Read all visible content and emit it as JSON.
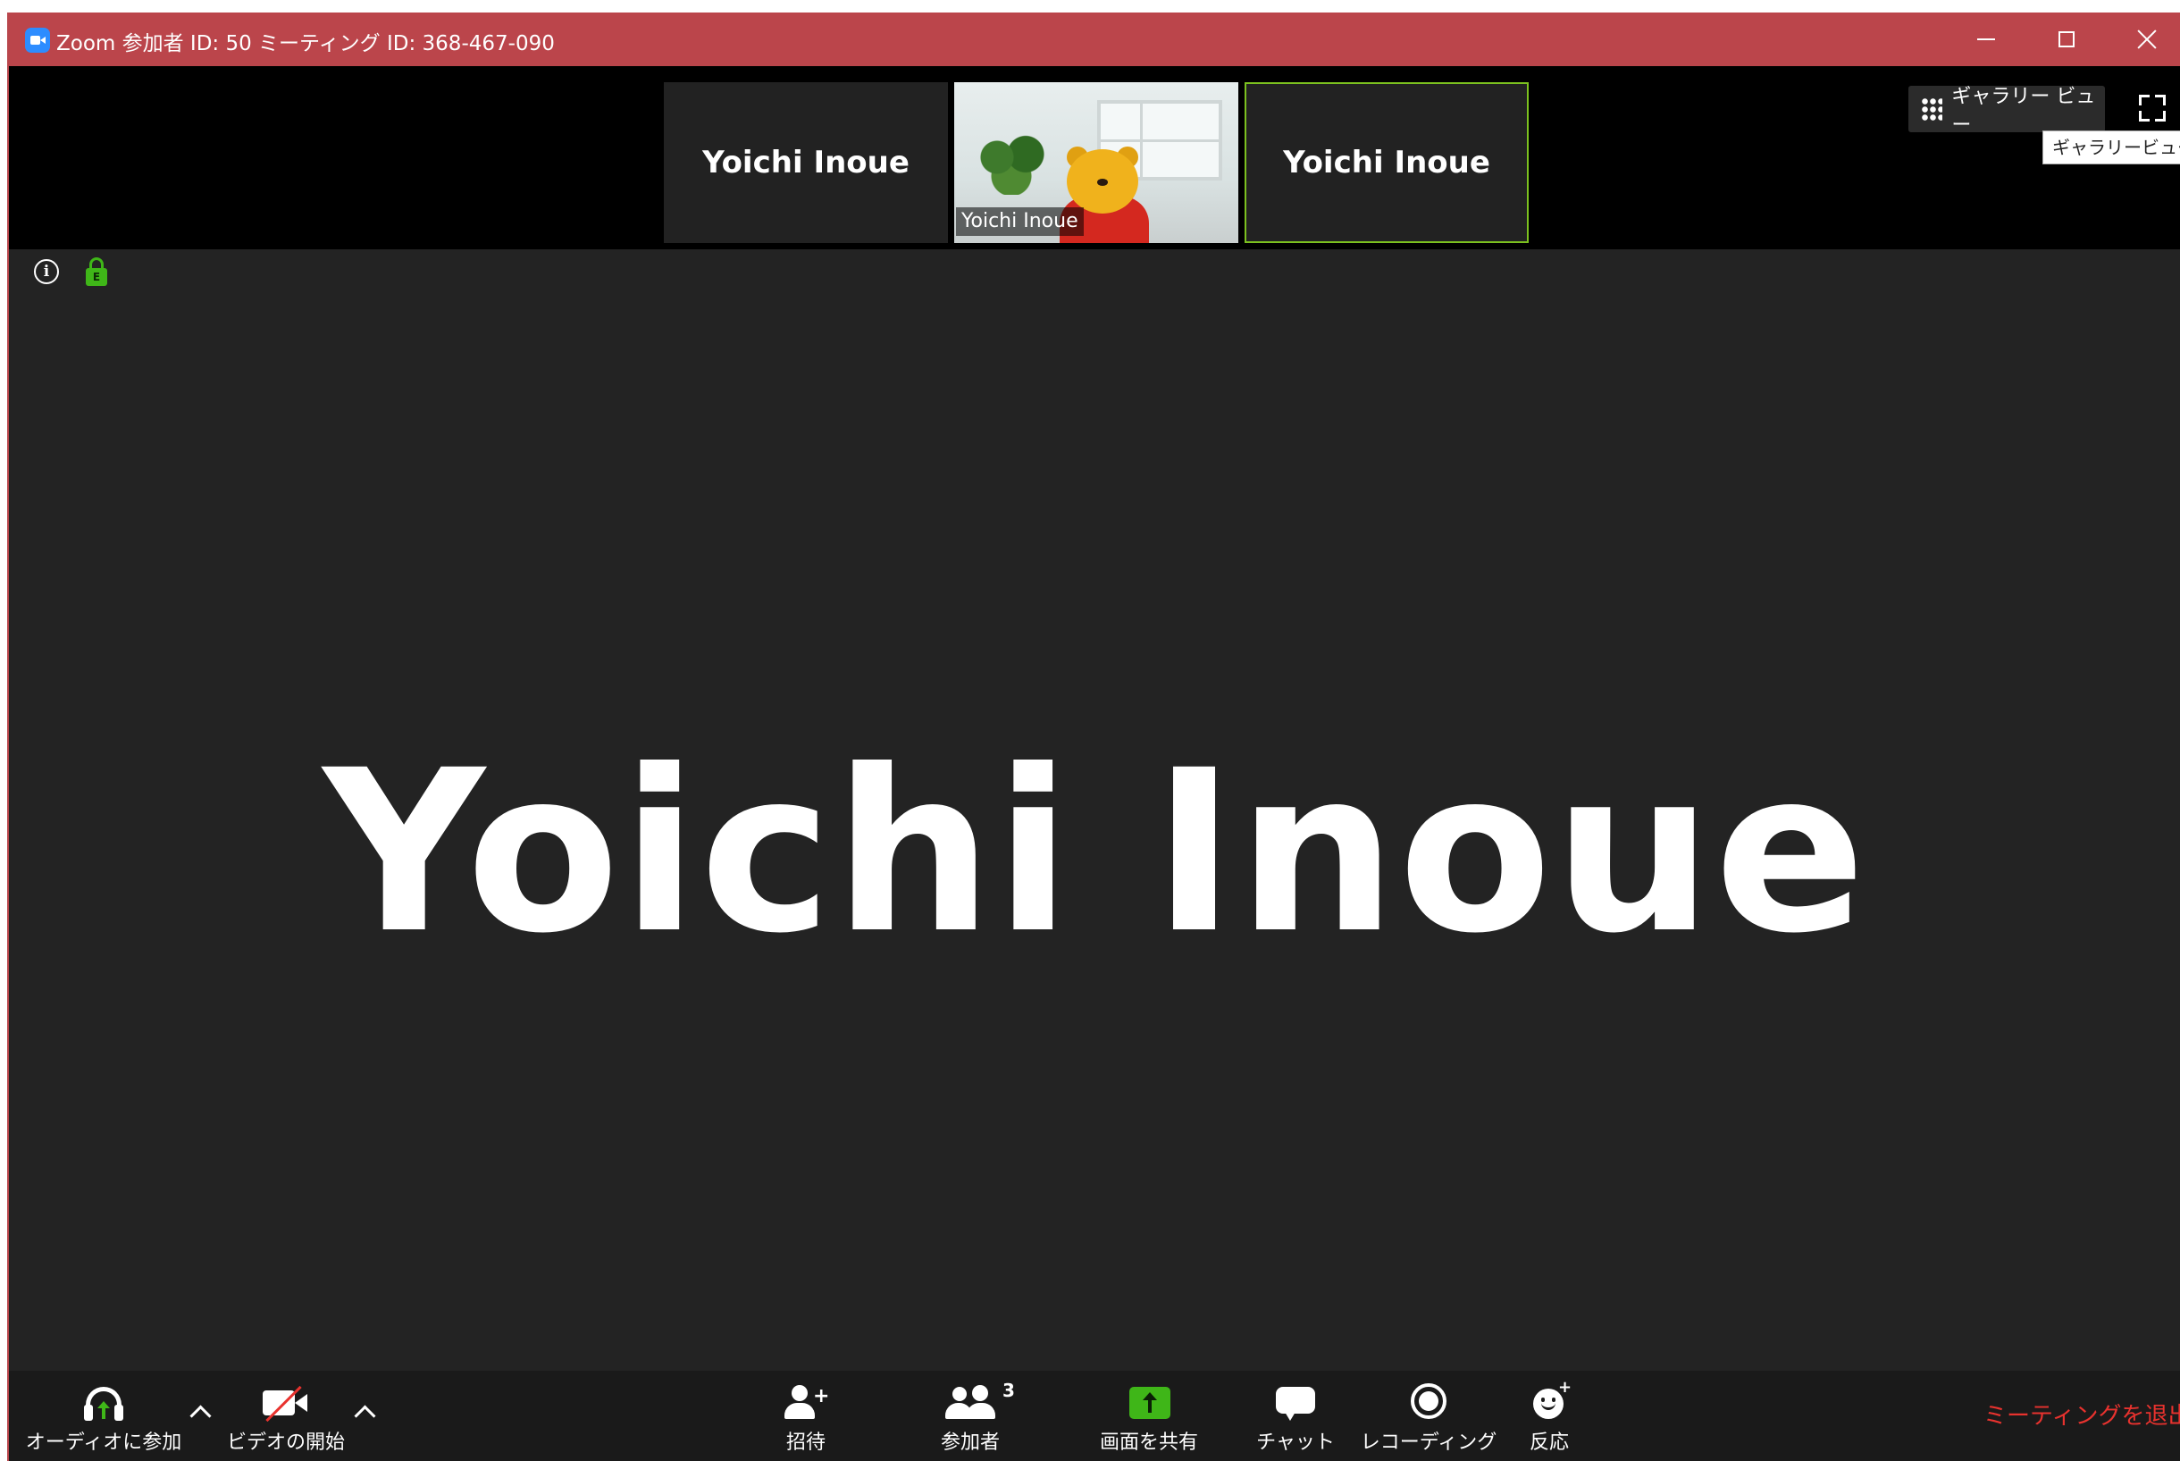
{
  "window": {
    "title": "Zoom 参加者 ID: 50 ミーティング ID: 368-467-090"
  },
  "strip": {
    "thumbnails": [
      {
        "name": "Yoichi Inoue"
      },
      {
        "name": "Yoichi Inoue",
        "video": true
      },
      {
        "name": "Yoichi Inoue",
        "active": true
      }
    ]
  },
  "view": {
    "gallery_button": "ギャラリー ビュー",
    "tooltip": "ギャラリービュー"
  },
  "status": {
    "encryption_letter": "E",
    "info_glyph": "i"
  },
  "main": {
    "speaker_name": "Yoichi Inoue"
  },
  "toolbar": {
    "audio": "オーディオに参加",
    "video": "ビデオの開始",
    "invite": "招待",
    "participants": "参加者",
    "participants_count": "3",
    "share": "画面を共有",
    "chat": "チャット",
    "record": "レコーディング",
    "reactions": "反応",
    "leave": "ミーティングを退出"
  },
  "colors": {
    "titlebar": "#bb454b",
    "active_border": "#7cc11f",
    "share_green": "#3fb618",
    "leave_red": "#e8322e"
  }
}
